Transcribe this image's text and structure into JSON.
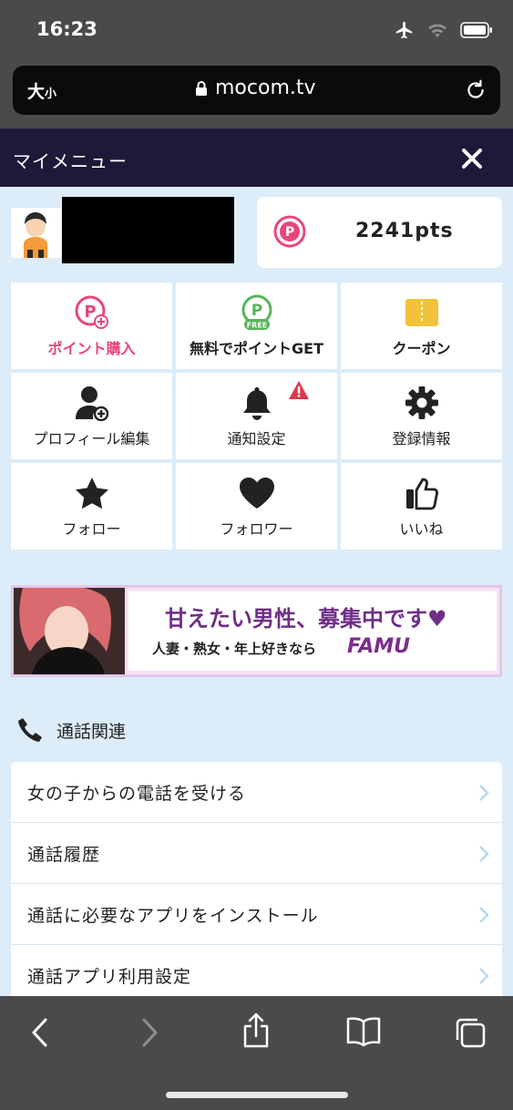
{
  "status": {
    "time": "16:23"
  },
  "browser": {
    "text_size_big": "大",
    "text_size_small": "小",
    "url": "mocom.tv"
  },
  "header": {
    "title": "マイメニュー"
  },
  "points": {
    "value": "2241pts"
  },
  "grid": [
    {
      "label": "ポイント購入",
      "icon": "points-plus-icon"
    },
    {
      "label": "無料でポイントGET",
      "icon": "points-free-icon",
      "badge": "FREE"
    },
    {
      "label": "クーポン",
      "icon": "coupon-icon"
    },
    {
      "label": "プロフィール編集",
      "icon": "user-add-icon"
    },
    {
      "label": "通知設定",
      "icon": "bell-icon"
    },
    {
      "label": "登録情報",
      "icon": "gear-icon"
    },
    {
      "label": "フォロー",
      "icon": "star-icon"
    },
    {
      "label": "フォロワー",
      "icon": "heart-icon"
    },
    {
      "label": "いいね",
      "icon": "thumbs-up-icon"
    }
  ],
  "banner": {
    "headline": "甘えたい男性、募集中です♥",
    "sub": "人妻・熟女・年上好きなら",
    "brand": "FAMU"
  },
  "section": {
    "title": "通話関連"
  },
  "list": [
    "女の子からの電話を受ける",
    "通話履歴",
    "通話に必要なアプリをインストール",
    "通話アプリ利用設定"
  ],
  "colors": {
    "accent_pink": "#e8457d",
    "accent_green": "#57b55a",
    "header_bg": "#1f1838",
    "page_bg": "#dcecf8",
    "alert": "#e0344b"
  }
}
